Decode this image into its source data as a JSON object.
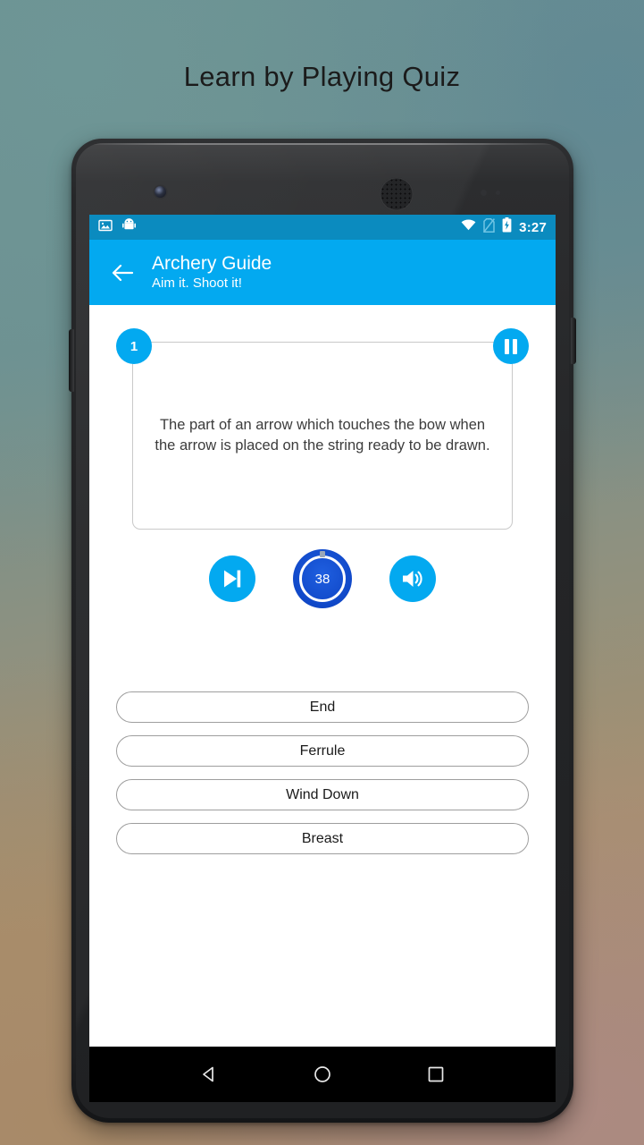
{
  "headline": "Learn by Playing Quiz",
  "statusbar": {
    "time": "3:27",
    "icons": [
      "image-icon",
      "android-robot-icon",
      "wifi-icon",
      "no-sim-icon",
      "battery-charging-icon"
    ]
  },
  "appbar": {
    "back_icon": "back-arrow-icon",
    "title": "Archery Guide",
    "subtitle": "Aim it. Shoot it!"
  },
  "question_card": {
    "number": "1",
    "pause_icon": "pause-icon",
    "text": "The part of an arrow which touches the bow when the arrow is placed on the string ready to be drawn."
  },
  "controls": {
    "skip_icon": "skip-next-icon",
    "timer_value": "38",
    "sound_icon": "volume-up-icon"
  },
  "answers": [
    {
      "label": "End"
    },
    {
      "label": "Ferrule"
    },
    {
      "label": "Wind Down"
    },
    {
      "label": "Breast"
    }
  ],
  "navbar": {
    "back": "nav-back-icon",
    "home": "nav-home-icon",
    "recents": "nav-recents-icon"
  },
  "colors": {
    "accent": "#03a9f0",
    "statusbar": "#0b8bbf",
    "timer": "#1048c8"
  }
}
